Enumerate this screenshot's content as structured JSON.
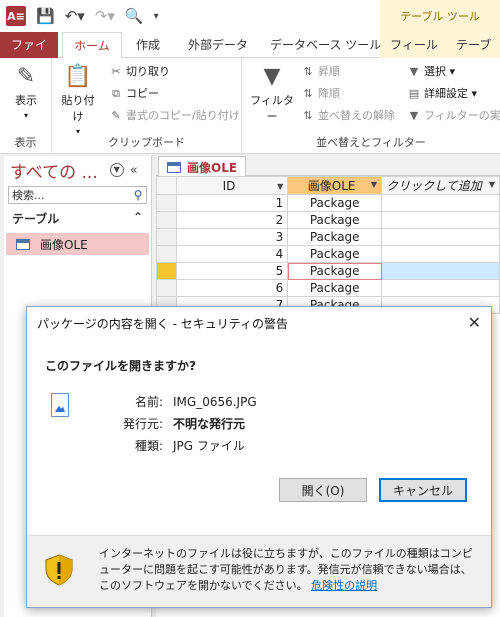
{
  "titlebar": {
    "app_icon": "A≡",
    "table_tools": "テーブル ツール"
  },
  "tabs": {
    "file": "ファイル",
    "home": "ホーム",
    "create": "作成",
    "external": "外部データ",
    "dbtools": "データベース ツール",
    "fields": "フィールド",
    "table": "テーブル"
  },
  "ribbon": {
    "view_label": "表示",
    "view_group": "表示",
    "paste_label": "貼り付け",
    "cut": "切り取り",
    "copy": "コピー",
    "format_painter": "書式のコピー/貼り付け",
    "clipboard_group": "クリップボード",
    "filter_label": "フィルター",
    "ascending": "昇順",
    "descending": "降順",
    "remove_sort": "並べ替えの解除",
    "selection": "選択",
    "advanced": "詳細設定",
    "toggle_filter": "フィルターの実行",
    "sortfilter_group": "並べ替えとフィルター"
  },
  "nav": {
    "title": "すべての ...",
    "search_placeholder": "検索...",
    "section": "テーブル",
    "item": "画像OLE"
  },
  "doc": {
    "tab": "画像OLE",
    "columns": [
      "ID",
      "画像OLE",
      "クリックして追加"
    ],
    "rows": [
      {
        "id": "1",
        "ole": "Package"
      },
      {
        "id": "2",
        "ole": "Package"
      },
      {
        "id": "3",
        "ole": "Package"
      },
      {
        "id": "4",
        "ole": "Package"
      },
      {
        "id": "5",
        "ole": "Package"
      },
      {
        "id": "6",
        "ole": "Package"
      },
      {
        "id": "7",
        "ole": "Package"
      }
    ]
  },
  "dialog": {
    "title": "パッケージの内容を開く - セキュリティの警告",
    "question": "このファイルを開きますか?",
    "name_key": "名前:",
    "name_val": "IMG_0656.JPG",
    "publisher_key": "発行元:",
    "publisher_val": "不明な発行元",
    "type_key": "種類:",
    "type_val": "JPG ファイル",
    "open_button": "開く(O)",
    "cancel_button": "キャンセル",
    "warning_text": "インターネットのファイルは役に立ちますが、このファイルの種類はコンピューターに問題を起こす可能性があります。発信元が信頼できない場合は、このソフトウェアを開かないでください。",
    "risk_link": "危険性の説明"
  }
}
